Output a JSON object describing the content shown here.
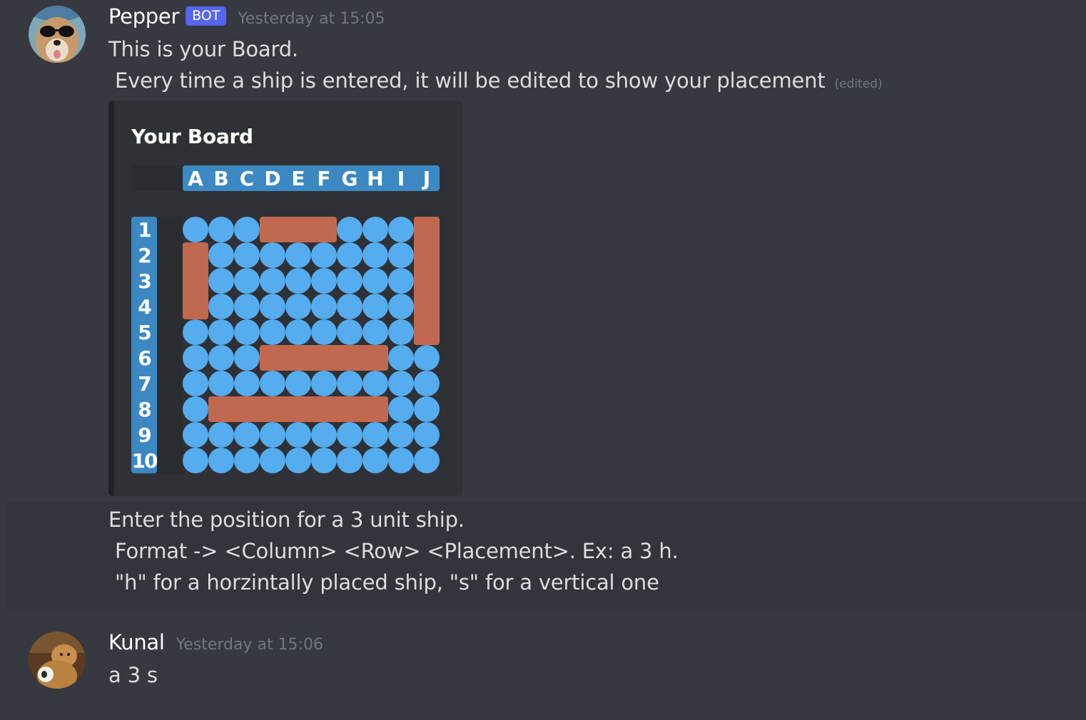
{
  "messages": [
    {
      "author": "Pepper",
      "bot_tag": "BOT",
      "timestamp": "Yesterday at 15:05",
      "lines": [
        "This is your Board.",
        " Every time a ship is entered, it will be edited to show your placement"
      ],
      "edited_label": "(edited)",
      "embed": {
        "title": "Your Board",
        "columns": [
          "A",
          "B",
          "C",
          "D",
          "E",
          "F",
          "G",
          "H",
          "I",
          "J"
        ],
        "rows": [
          "1",
          "2",
          "3",
          "4",
          "5",
          "6",
          "7",
          "8",
          "9",
          "10"
        ],
        "grid": [
          "WWWSSSWWWS",
          "SWWWWWWWWS",
          "SWWWWWWWWS",
          "SWWWWWWWWS",
          "WWWWWWWWWS",
          "WWWSSSSSWW",
          "WWWWWWWWWW",
          "WSSSSSSSWW",
          "WWWWWWWWWW",
          "WWWWWWWWWW"
        ],
        "colors": {
          "water": "#55acee",
          "ship": "#c1694f",
          "header": "#3b88c3"
        }
      },
      "followup_lines": [
        "Enter the position for a 3 unit ship.",
        " Format -> <Column> <Row> <Placement>. Ex: a 3 h.",
        " \"h\" for a horzintally placed ship, \"s\" for a vertical one"
      ]
    },
    {
      "author": "Kunal",
      "timestamp": "Yesterday at 15:06",
      "lines": [
        "a 3 s"
      ]
    }
  ],
  "theme": {
    "background": "#36393f",
    "embed_bg": "#2f3136",
    "bot_tag": "#5865f2",
    "muted": "#72767d"
  }
}
